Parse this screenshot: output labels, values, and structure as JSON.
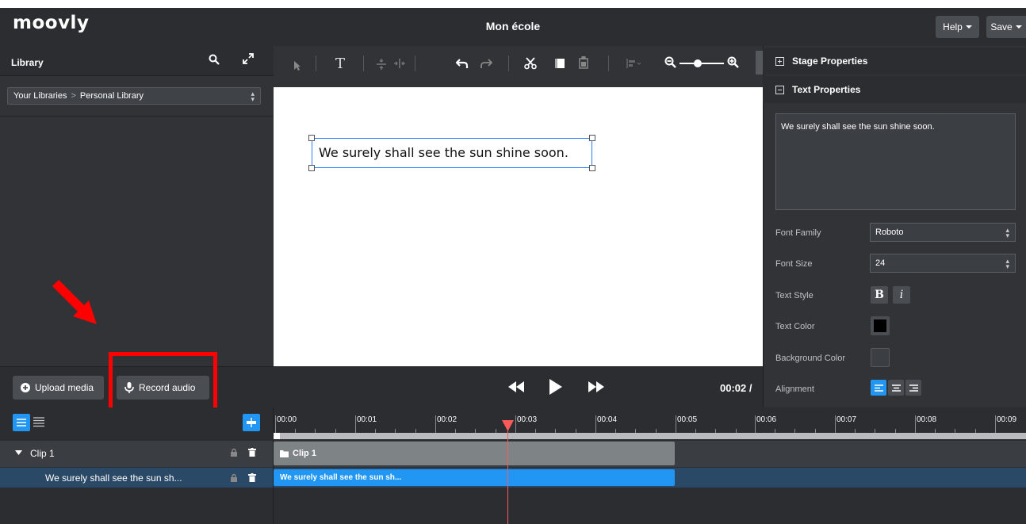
{
  "app": {
    "logo": "moovly",
    "project_title": "Mon école",
    "help_label": "Help",
    "save_label": "Save"
  },
  "library": {
    "title": "Library",
    "breadcrumb_root": "Your Libraries",
    "breadcrumb_current": "Personal Library",
    "upload_label": "Upload media",
    "record_label": "Record audio"
  },
  "stage": {
    "text": "We surely shall see the sun shine soon.",
    "timecode": "00:02 /"
  },
  "properties": {
    "stage_properties": "Stage Properties",
    "text_properties": "Text Properties",
    "text_value": "We surely shall see the sun shine soon.",
    "font_family_label": "Font Family",
    "font_family_value": "Roboto",
    "font_size_label": "Font Size",
    "font_size_value": "24",
    "text_style_label": "Text Style",
    "bold_label": "B",
    "italic_label": "i",
    "text_color_label": "Text Color",
    "text_color": "#000000",
    "background_color_label": "Background Color",
    "alignment_label": "Alignment"
  },
  "timeline": {
    "ticks": [
      "00:00",
      "00:01",
      "00:02",
      "00:03",
      "00:04",
      "00:05",
      "00:06",
      "00:07",
      "00:08",
      "00:09"
    ],
    "clip_label": "Clip 1",
    "clip_bar_label": "Clip 1",
    "text_row_label": "We surely shall see the sun sh...",
    "text_bar_label": "We surely shall see the sun sh..."
  },
  "colors": {
    "accent": "#2196f3",
    "annotation": "#ff0000",
    "playhead": "#ff5a5a"
  }
}
